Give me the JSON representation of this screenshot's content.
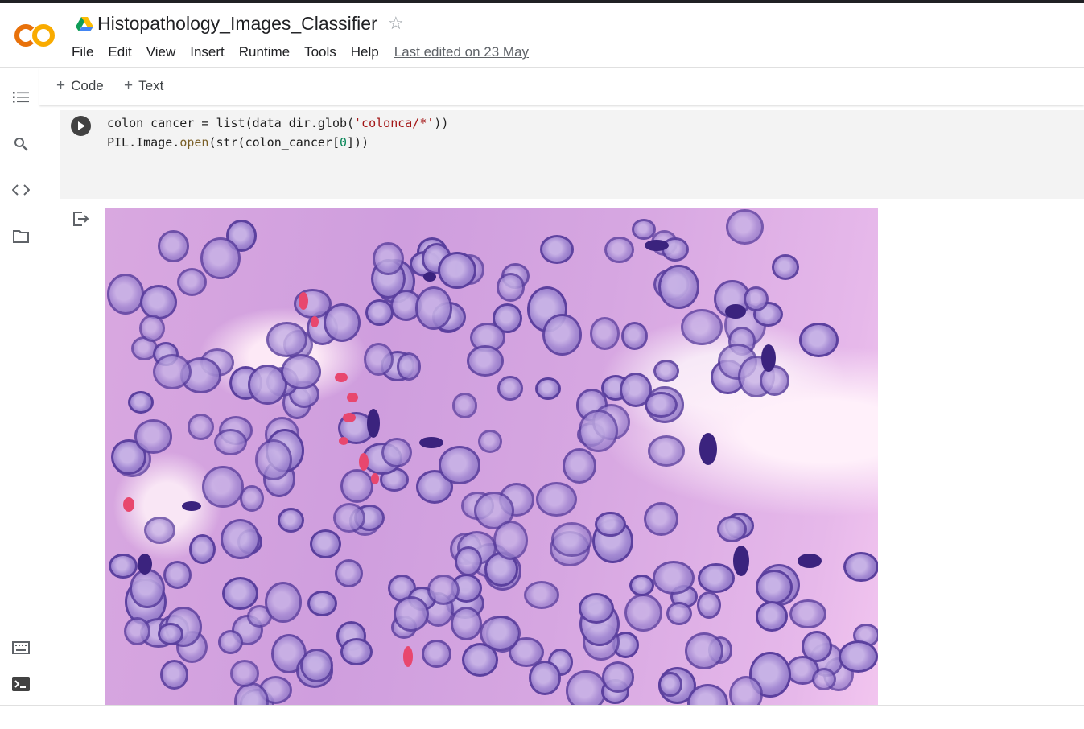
{
  "app": {
    "logo_text": "CO",
    "notebook_title": "Histopathology_Images_Classifier",
    "colors": {
      "logo_orange": "#f9ab00",
      "logo_dark_orange": "#e8710a"
    }
  },
  "menu": {
    "items": [
      "File",
      "Edit",
      "View",
      "Insert",
      "Runtime",
      "Tools",
      "Help"
    ],
    "last_edited": "Last edited on 23 May"
  },
  "toolbar": {
    "add_code_label": "Code",
    "add_text_label": "Text"
  },
  "sidebar": {
    "icons": [
      "table-of-contents-icon",
      "search-icon",
      "code-snippets-icon",
      "files-icon",
      "command-palette-icon",
      "terminal-icon"
    ]
  },
  "cell": {
    "line1": {
      "a": "colon_cancer = list(data_dir.glob(",
      "b": "'colonca/*'",
      "c": "))"
    },
    "line2": {
      "a": "PIL.Image.",
      "b": "open",
      "c": "(str(colon_cancer[",
      "d": "0",
      "e": "]))"
    }
  },
  "output": {
    "image_description": "histopathology-colon-cancer-image"
  }
}
